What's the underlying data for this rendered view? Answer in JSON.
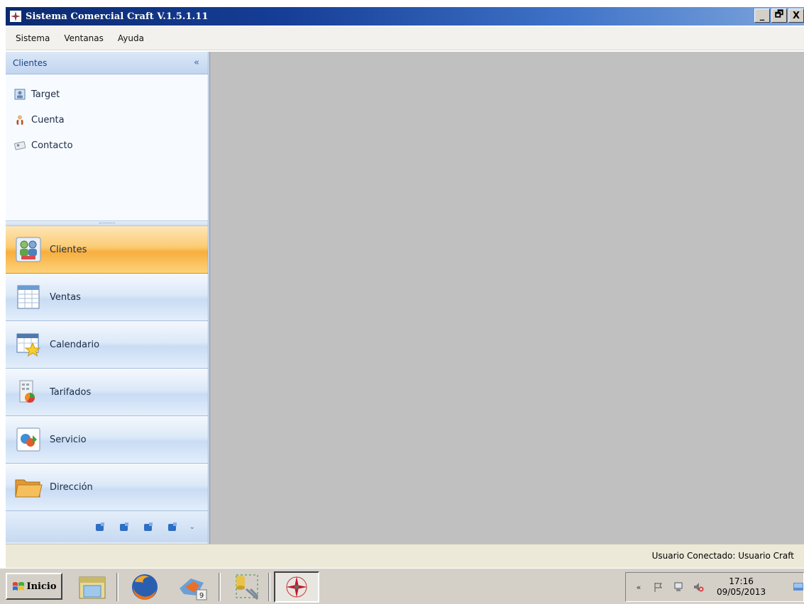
{
  "window": {
    "title": "Sistema Comercial Craft V.1.5.1.11",
    "controls": {
      "minimize": "_",
      "restore": "🗗",
      "close": "X"
    }
  },
  "menu": [
    "Sistema",
    "Ventanas",
    "Ayuda"
  ],
  "nav": {
    "header": "Clientes",
    "collapse_glyph": "«",
    "links": [
      {
        "label": "Target",
        "icon": "target-user-icon"
      },
      {
        "label": "Cuenta",
        "icon": "account-user-icon"
      },
      {
        "label": "Contacto",
        "icon": "contact-card-icon"
      }
    ],
    "buttons": [
      {
        "label": "Clientes",
        "icon": "clients-group-icon",
        "active": true
      },
      {
        "label": "Ventas",
        "icon": "sales-sheet-icon",
        "active": false
      },
      {
        "label": "Calendario",
        "icon": "calendar-star-icon",
        "active": false
      },
      {
        "label": "Tarifados",
        "icon": "rates-chart-icon",
        "active": false
      },
      {
        "label": "Servicio",
        "icon": "service-icon",
        "active": false
      },
      {
        "label": "Dirección",
        "icon": "folder-icon",
        "active": false
      }
    ],
    "overflow_chevron": "⌄"
  },
  "status": {
    "user": "Usuario Conectado: Usuario Craft"
  },
  "taskbar": {
    "start_label": "Inicio",
    "clock_time": "17:16",
    "clock_date": "09/05/2013",
    "toolbox_badge": "9",
    "tray_arrow": "«"
  },
  "colors": {
    "title_bar": "#163e97",
    "nav_active": "#f7ae3e",
    "workspace": "#c0c0c0"
  }
}
